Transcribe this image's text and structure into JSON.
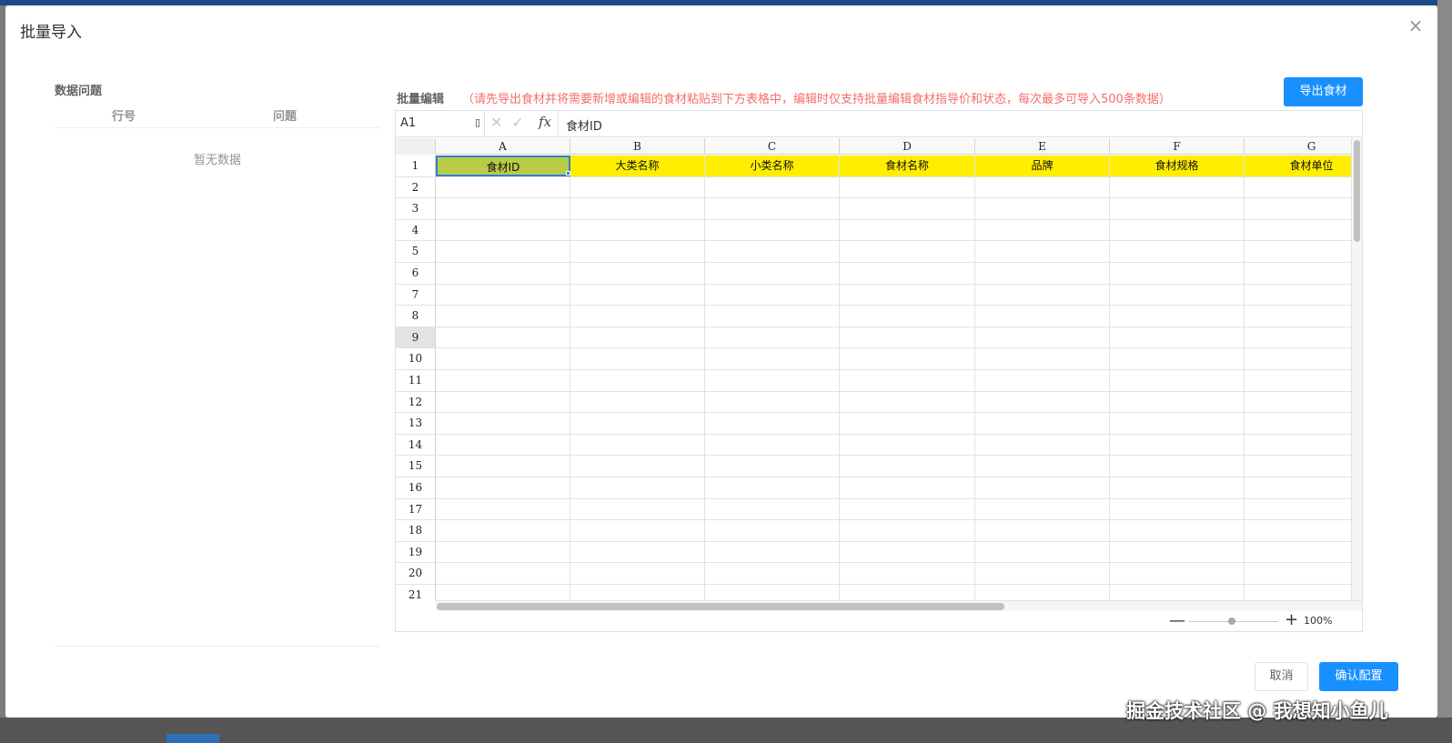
{
  "dialog": {
    "title": "批量导入",
    "close_icon": "×"
  },
  "issues": {
    "heading": "数据问题",
    "columns": [
      "行号",
      "问题"
    ],
    "empty_text": "暂无数据"
  },
  "editor": {
    "label": "批量编辑",
    "hint": "（请先导出食材并将需要新增或编辑的食材粘贴到下方表格中，编辑时仅支持批量编辑食材指导价和状态，每次最多可导入500条数据）",
    "export_button": "导出食材"
  },
  "spreadsheet": {
    "cell_ref": "A1",
    "formula_value": "食材ID",
    "fx_label": "fx",
    "columns": [
      "A",
      "B",
      "C",
      "D",
      "E",
      "F",
      "G"
    ],
    "row_numbers": [
      "1",
      "2",
      "3",
      "4",
      "5",
      "6",
      "7",
      "8",
      "9",
      "10",
      "11",
      "12",
      "13",
      "14",
      "15",
      "16",
      "17",
      "18",
      "19",
      "20",
      "21"
    ],
    "header_values": [
      "食材ID",
      "大类名称",
      "小类名称",
      "食材名称",
      "品牌",
      "食材规格",
      "食材单位"
    ],
    "highlight_color": "#ffee00",
    "active_cell_color": "#b8cc48",
    "selected_row": "9",
    "zoom": {
      "minus": "—",
      "plus": "+",
      "percent": "100%"
    }
  },
  "footer": {
    "cancel": "取消",
    "confirm": "确认配置"
  },
  "watermark": "掘金技术社区 @ 我想知小鱼儿"
}
